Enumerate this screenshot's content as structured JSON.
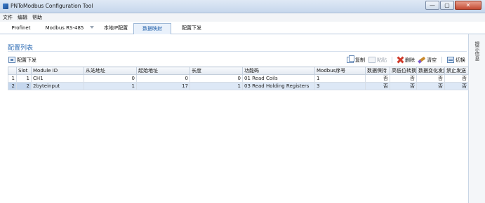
{
  "window": {
    "title": "PNToModbus Configuration Tool",
    "min_glyph": "—",
    "max_glyph": "▢",
    "close_glyph": "✕"
  },
  "menu": [
    "文件",
    "编辑",
    "帮助"
  ],
  "tabs": [
    "Profinet",
    "Modbus RS-485",
    "本地IP配置",
    "数据映射",
    "配置下发"
  ],
  "active_tab": "数据映射",
  "section": {
    "title": "配置列表"
  },
  "toolbar": {
    "download_label": "配置下发",
    "copy_label": "复制",
    "paste_label": "粘贴",
    "delete_label": "删除",
    "clear_label": "清空",
    "switch_label": "切换"
  },
  "table": {
    "columns": [
      "",
      "Slot",
      "Module ID",
      "从站地址",
      "起始地址",
      "长度",
      "功能码",
      "Modbus序号",
      "数据保持",
      "高低位转换",
      "数据变化发送",
      "禁止发送"
    ],
    "rows": [
      [
        "1",
        "1",
        "CH1",
        "0",
        "0",
        "0",
        "01 Read Coils",
        "1",
        "否",
        "否",
        "否",
        "否"
      ],
      [
        "2",
        "2",
        "2byteinput",
        "1",
        "17",
        "1",
        "03 Read Holding Registers",
        "3",
        "否",
        "否",
        "否",
        "否"
      ]
    ],
    "selected_row": 1
  },
  "sidebar": {
    "label": "提示信息"
  },
  "colors": {
    "accent": "#2f6db5",
    "selection": "#dde8f6",
    "delete_icon": "#d03a2a"
  }
}
